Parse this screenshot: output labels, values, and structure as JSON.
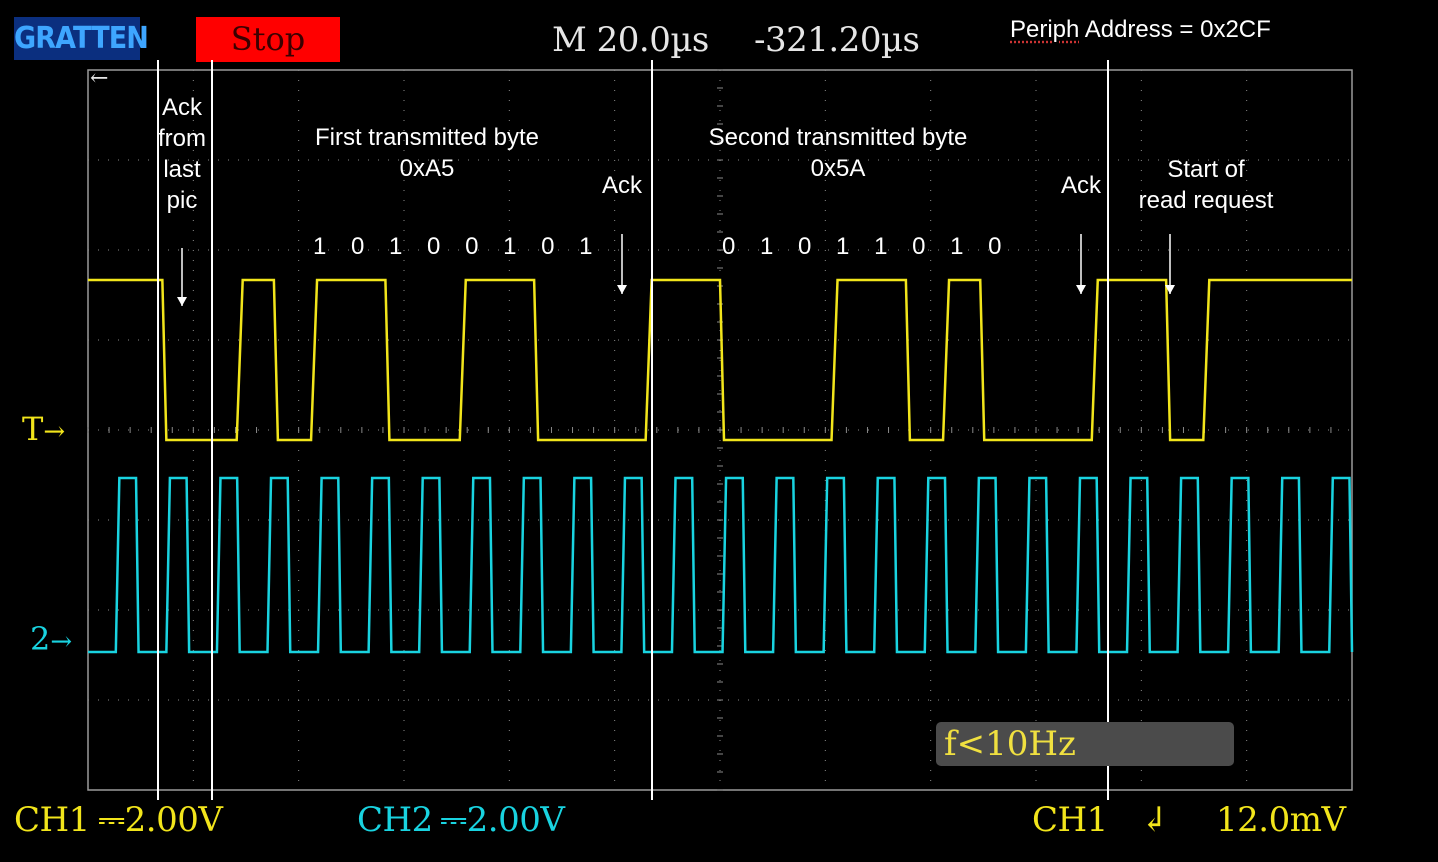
{
  "header": {
    "logo": "GRATTEN",
    "run_state": "Stop",
    "timebase": "M 20.0µs",
    "trigger_position": "-321.20µs",
    "periph_label": "Periph",
    "periph_rest": " Address = 0x2CF"
  },
  "annotations": {
    "ack_last_pic": [
      "Ack",
      "from",
      "last",
      "pic"
    ],
    "first_byte_title": "First transmitted byte",
    "first_byte_value": "0xA5",
    "first_byte_bits": "1 0 1 0 0 1 0 1",
    "ack1": "Ack",
    "second_byte_title": "Second transmitted byte",
    "second_byte_value": "0x5A",
    "second_byte_bits": "0 1 0 1 1 0 1 0",
    "ack2": "Ack",
    "read_request": [
      "Start of",
      "read request"
    ]
  },
  "markers": {
    "trigger": "T",
    "ch2": "2"
  },
  "frequency_readout": "f<10Hz",
  "footer": {
    "ch1_label": "CH1",
    "ch1_scale": "2.00V",
    "ch2_label": "CH2",
    "ch2_scale": "2.00V",
    "trig_source": "CH1",
    "trig_slope_icon": "falling-edge-icon",
    "trig_level": "12.0mV"
  },
  "colors": {
    "ch1": "#f2e51b",
    "ch2": "#19d3e0",
    "grid": "#8a8a8a",
    "stop_bg": "#ff0000",
    "logo_bg": "#0b2f7f"
  },
  "traces": {
    "ch1_levels": [
      1,
      1,
      0,
      0,
      1,
      0,
      1,
      1,
      0,
      0,
      1,
      1,
      0,
      0,
      0,
      1,
      1,
      0,
      0,
      0,
      1,
      1,
      0,
      1,
      0,
      0,
      0,
      1,
      1,
      0,
      1,
      1,
      1,
      1
    ],
    "ch2_clock_cycles": 25
  }
}
